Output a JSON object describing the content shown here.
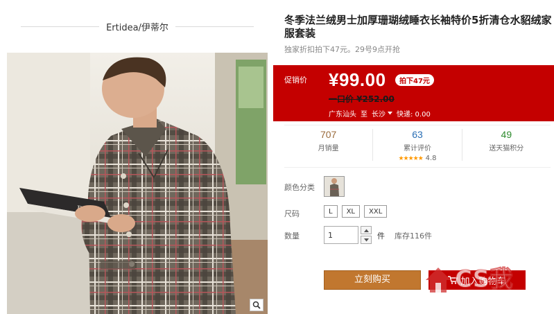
{
  "brand": {
    "name": "Ertidea/伊蒂尔"
  },
  "product": {
    "title": "冬季法兰绒男士加厚珊瑚绒睡衣长袖特价5折清仓水貂绒家服套装",
    "subtitle": "独家折扣拍下47元。29号9点开抢"
  },
  "price": {
    "label": "促销价",
    "current": "¥99.00",
    "badge": "拍下47元",
    "original_prefix": "一口价 ¥",
    "original_value": "252.00",
    "origin": "广东汕头",
    "to": "至",
    "destination": "长沙",
    "shipping": "快递: 0.00",
    "bg_color": "#c40000"
  },
  "stats": [
    {
      "num": "707",
      "label": "月销量",
      "color": "#9a6a3a"
    },
    {
      "num": "63",
      "label": "累计评价",
      "color": "#2a6fb5",
      "stars": "★★★★★",
      "rating": "4.8"
    },
    {
      "num": "49",
      "label": "送天猫积分",
      "color": "#2e8b2e"
    }
  ],
  "options": {
    "color_label": "颜色分类",
    "size_label": "尺码",
    "sizes": [
      "L",
      "XL",
      "XXL"
    ],
    "qty_label": "数量",
    "qty_value": "1",
    "qty_unit": "件",
    "stock": "库存116件"
  },
  "actions": {
    "buy": "立刻购买",
    "cart": "加入购物车"
  },
  "watermark": {
    "text": "CS我"
  },
  "icons": {
    "zoom": "magnifier-icon",
    "cart": "cart-icon",
    "dropdown": "chevron-down-icon"
  }
}
